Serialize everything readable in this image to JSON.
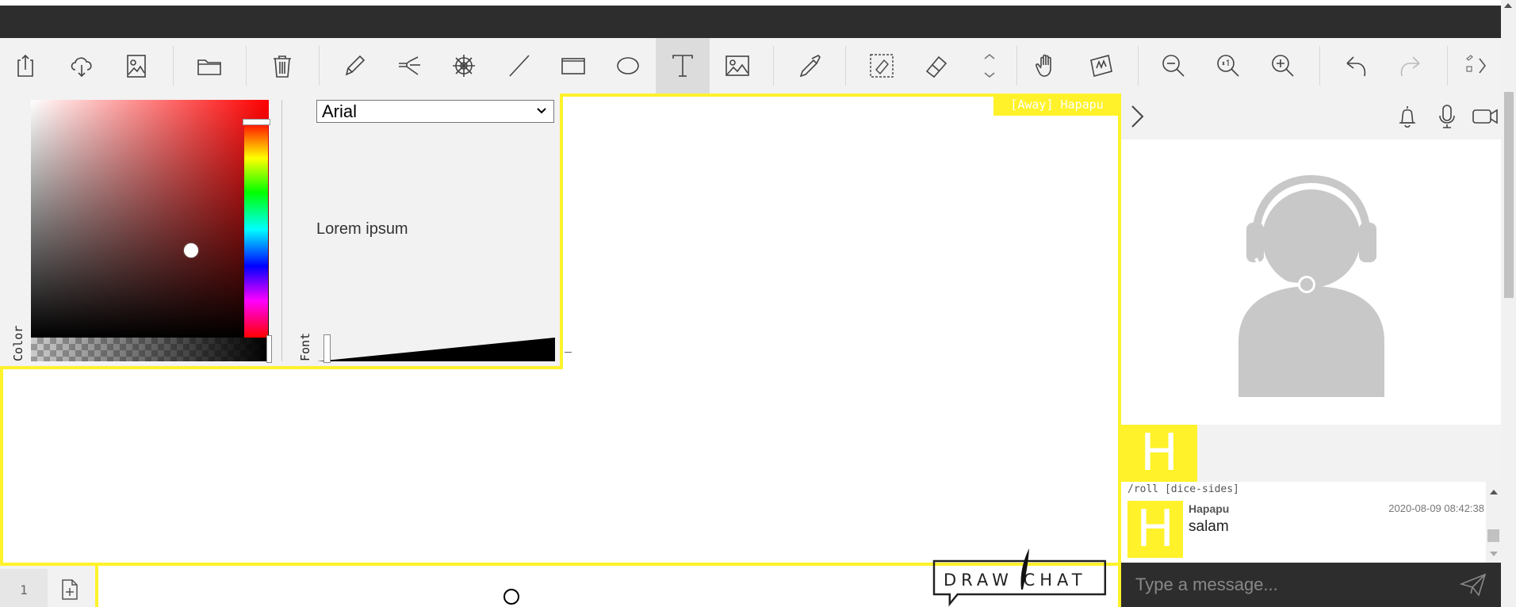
{
  "toolbar": {
    "items": [
      {
        "name": "export-button",
        "icon": "export-icon"
      },
      {
        "name": "cloud-upload-button",
        "icon": "cloud-upload-icon"
      },
      {
        "name": "save-image-button",
        "icon": "image-file-icon"
      },
      {
        "name": "open-folder-button",
        "icon": "folder-icon"
      },
      {
        "name": "delete-button",
        "icon": "trash-icon"
      },
      {
        "name": "pencil-tool",
        "icon": "pencil-icon"
      },
      {
        "name": "brush-tool",
        "icon": "brush-icon"
      },
      {
        "name": "pattern-tool",
        "icon": "wheel-icon"
      },
      {
        "name": "line-tool",
        "icon": "line-icon"
      },
      {
        "name": "rectangle-tool",
        "icon": "rectangle-icon"
      },
      {
        "name": "ellipse-tool",
        "icon": "ellipse-icon"
      },
      {
        "name": "text-tool",
        "icon": "text-icon",
        "active": true
      },
      {
        "name": "image-tool",
        "icon": "image-icon"
      },
      {
        "name": "eyedropper-tool",
        "icon": "eyedropper-icon"
      },
      {
        "name": "select-eraser-tool",
        "icon": "select-eraser-icon"
      },
      {
        "name": "eraser-tool",
        "icon": "eraser-icon"
      },
      {
        "name": "pan-tool",
        "icon": "hand-icon"
      },
      {
        "name": "smudge-tool",
        "icon": "smudge-icon"
      },
      {
        "name": "zoom-out-button",
        "icon": "zoom-out-icon"
      },
      {
        "name": "zoom-reset-button",
        "icon": "zoom-reset-icon"
      },
      {
        "name": "zoom-in-button",
        "icon": "zoom-in-icon"
      },
      {
        "name": "undo-button",
        "icon": "undo-icon"
      },
      {
        "name": "redo-button",
        "icon": "redo-icon"
      }
    ],
    "expand_icon": "chevron-right-icon"
  },
  "color_panel": {
    "label": "Color",
    "selected_hue": "#ff0000"
  },
  "font_panel": {
    "label": "Font",
    "font_selected": "Arial",
    "preview_text": "Lorem ipsum"
  },
  "canvas": {
    "status_tag": "[Away] Hapapu",
    "page_number": "1",
    "accent": "#fff22a"
  },
  "logo": {
    "text": "DRAW CHAT"
  },
  "right_panel": {
    "user_initial": "H",
    "chat": {
      "hint": "/roll [dice-sides]",
      "messages": [
        {
          "author": "Hapapu",
          "time": "2020-08-09 08:42:38",
          "text": "salam",
          "initial": "H"
        }
      ],
      "input_placeholder": "Type a message..."
    }
  }
}
